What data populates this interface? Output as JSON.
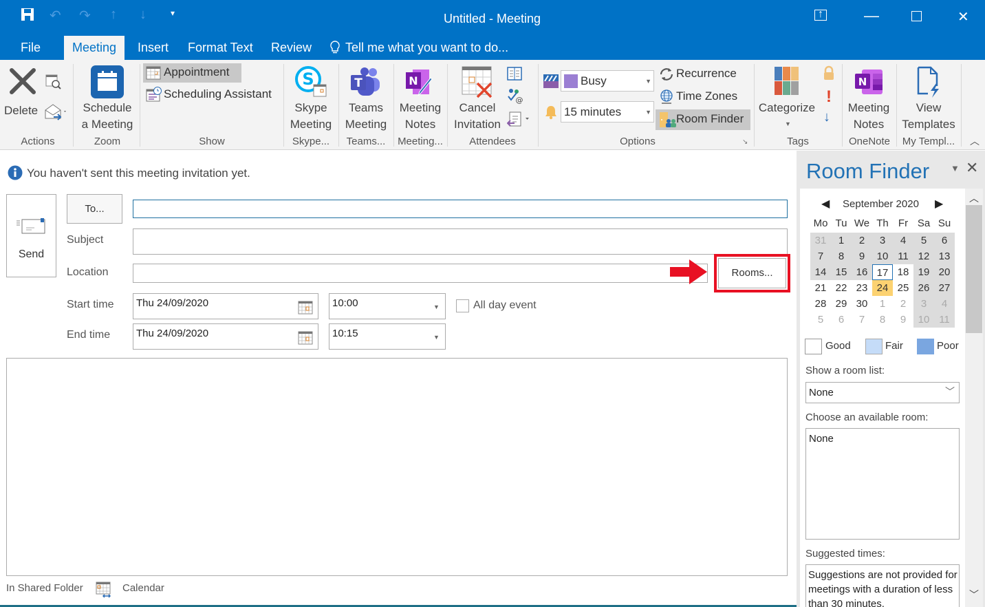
{
  "window": {
    "title": "Untitled - Meeting",
    "controls": {
      "restore_ribbon": "▭",
      "minimize": "—",
      "maximize": "☐",
      "close": "✕"
    }
  },
  "quick_access": {
    "save": "save-icon",
    "undo": "undo-icon",
    "redo": "redo-icon",
    "up": "up-arrow-icon",
    "down": "down-arrow-icon",
    "customize": "customize-qat-icon"
  },
  "tabs": [
    {
      "label": "File"
    },
    {
      "label": "Meeting",
      "active": true
    },
    {
      "label": "Insert"
    },
    {
      "label": "Format Text"
    },
    {
      "label": "Review"
    }
  ],
  "tell_me": "Tell me what you want to do...",
  "ribbon": {
    "actions": {
      "delete": "Delete",
      "group": "Actions"
    },
    "zoom": {
      "schedule_line1": "Schedule",
      "schedule_line2": "a Meeting",
      "group": "Zoom"
    },
    "show": {
      "appointment": "Appointment",
      "scheduling": "Scheduling Assistant",
      "group": "Show"
    },
    "skype": {
      "line1": "Skype",
      "line2": "Meeting",
      "group": "Skype..."
    },
    "teams": {
      "line1": "Teams",
      "line2": "Meeting",
      "group": "Teams..."
    },
    "notes": {
      "line1": "Meeting",
      "line2": "Notes",
      "group": "Meeting..."
    },
    "attendees": {
      "line1": "Cancel",
      "line2": "Invitation",
      "group": "Attendees"
    },
    "options": {
      "show_as": "Busy",
      "reminder": "15 minutes",
      "recurrence": "Recurrence",
      "time_zones": "Time Zones",
      "room_finder": "Room Finder",
      "group": "Options"
    },
    "tags": {
      "categorize": "Categorize",
      "group": "Tags"
    },
    "onenote": {
      "line1": "Meeting",
      "line2": "Notes",
      "group": "OneNote"
    },
    "templates": {
      "line1": "View",
      "line2": "Templates",
      "group": "My Templ..."
    }
  },
  "info_bar": "You haven't sent this meeting invitation yet.",
  "form": {
    "send": "Send",
    "to_button": "To...",
    "to_value": "",
    "subject_label": "Subject",
    "subject_value": "",
    "location_label": "Location",
    "location_value": "",
    "rooms_button": "Rooms...",
    "start_label": "Start time",
    "start_date": "Thu 24/09/2020",
    "start_time": "10:00",
    "end_label": "End time",
    "end_date": "Thu 24/09/2020",
    "end_time": "10:15",
    "all_day_label": "All day event",
    "all_day_checked": false,
    "body": ""
  },
  "footer": {
    "folder_label": "In Shared Folder",
    "folder_name": "Calendar"
  },
  "room_finder": {
    "title": "Room Finder",
    "month": "September 2020",
    "weekdays": [
      "Mo",
      "Tu",
      "We",
      "Th",
      "Fr",
      "Sa",
      "Su"
    ],
    "weeks": [
      [
        "31",
        "1",
        "2",
        "3",
        "4",
        "5",
        "6"
      ],
      [
        "7",
        "8",
        "9",
        "10",
        "11",
        "12",
        "13"
      ],
      [
        "14",
        "15",
        "16",
        "17",
        "18",
        "19",
        "20"
      ],
      [
        "21",
        "22",
        "23",
        "24",
        "25",
        "26",
        "27"
      ],
      [
        "28",
        "29",
        "30",
        "1",
        "2",
        "3",
        "4"
      ],
      [
        "5",
        "6",
        "7",
        "8",
        "9",
        "10",
        "11"
      ]
    ],
    "today": "17",
    "selected": "24",
    "legend": [
      {
        "label": "Good",
        "color": "#ffffff"
      },
      {
        "label": "Fair",
        "color": "#c5dcf8"
      },
      {
        "label": "Poor",
        "color": "#7aa6e0"
      }
    ],
    "room_list_label": "Show a room list:",
    "room_list_value": "None",
    "available_label": "Choose an available room:",
    "available_rooms": [
      "None"
    ],
    "suggested_label": "Suggested times:",
    "suggested_text": "Suggestions are not provided for meetings with a duration of less than 30 minutes."
  },
  "colors": {
    "brand": "#0072c6",
    "highlight": "#e81123",
    "selected_day": "#fcd271"
  }
}
